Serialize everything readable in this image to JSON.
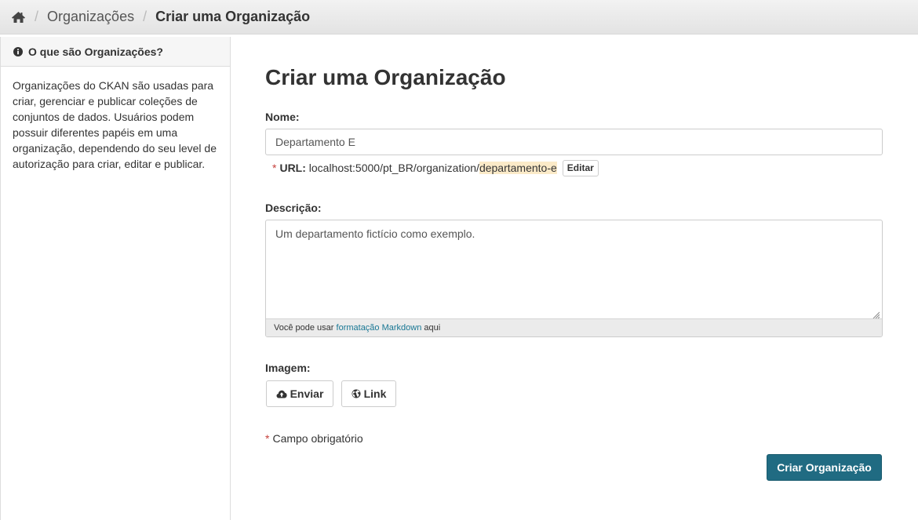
{
  "breadcrumb": {
    "home_icon": "home-icon",
    "items": [
      "Organizações",
      "Criar uma Organização"
    ]
  },
  "sidebar": {
    "heading": "O que são Organizações?",
    "heading_icon": "info-circle-icon",
    "body": "Organizações do CKAN são usadas para criar, gerenciar e publicar coleções de conjuntos de dados. Usuários podem possuir diferentes papéis em uma organização, dependendo do seu level de autorização para criar, editar e publicar."
  },
  "form": {
    "title": "Criar uma Organização",
    "name_label": "Nome:",
    "name_value": "Departamento E",
    "url_label": "URL:",
    "url_prefix": "localhost:5000/pt_BR/organization/",
    "url_slug": "departamento-e",
    "edit_label": "Editar",
    "description_label": "Descrição:",
    "description_value": "Um departamento fictício como exemplo.",
    "markdown_prefix": "Você pode usar ",
    "markdown_link": "formatação Markdown",
    "markdown_suffix": " aqui",
    "image_label": "Imagem:",
    "upload_label": "Enviar",
    "upload_icon": "cloud-upload-icon",
    "link_label": "Link",
    "link_icon": "globe-icon",
    "required_marker": "*",
    "required_note": "Campo obrigatório",
    "submit_label": "Criar Organização"
  },
  "colors": {
    "primary_button": "#206b82",
    "required_asterisk": "#c6403c",
    "slug_highlight": "#fbeac8",
    "link": "#187794"
  }
}
